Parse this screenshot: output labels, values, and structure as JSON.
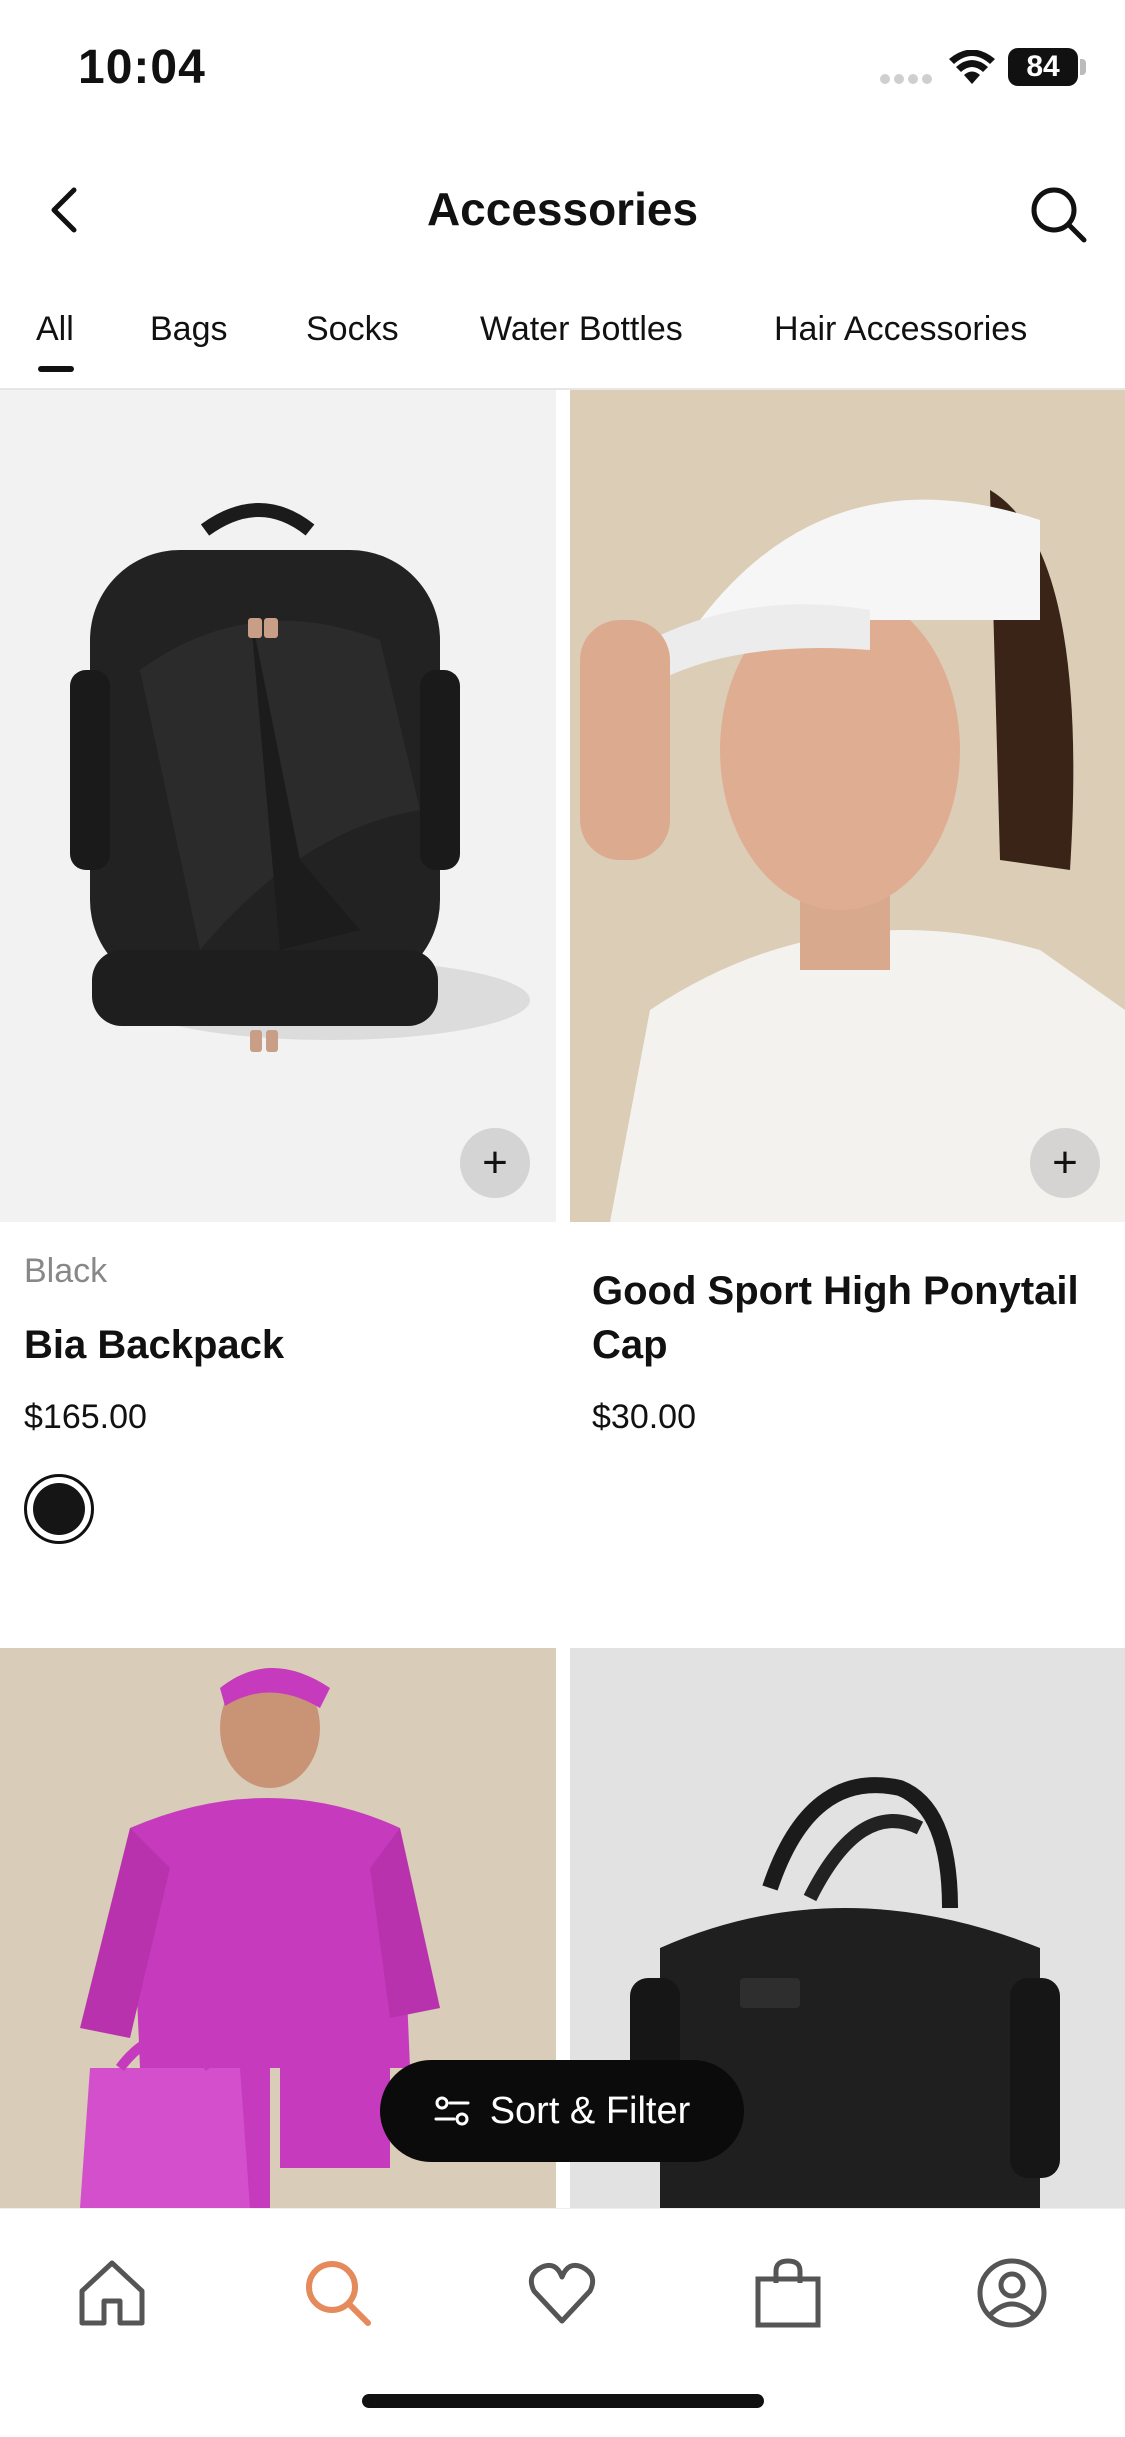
{
  "status_bar": {
    "time": "10:04",
    "battery": "84"
  },
  "header": {
    "title": "Accessories"
  },
  "tabs": [
    {
      "label": "All",
      "active": true
    },
    {
      "label": "Bags"
    },
    {
      "label": "Socks"
    },
    {
      "label": "Water Bottles"
    },
    {
      "label": "Hair Accessories"
    }
  ],
  "products": [
    {
      "color_label": "Black",
      "name": "Bia Backpack",
      "price": "$165.00",
      "swatch_color": "#151515"
    },
    {
      "name_line1": "Good Sport High Ponytail",
      "name_line2": "Cap",
      "price": "$30.00"
    }
  ],
  "sort_filter": {
    "label": "Sort & Filter"
  },
  "tabbar": {
    "items": [
      {
        "icon": "home-icon"
      },
      {
        "icon": "search-icon",
        "active": true,
        "color": "#E58A5B"
      },
      {
        "icon": "heart-icon"
      },
      {
        "icon": "bag-icon"
      },
      {
        "icon": "profile-icon"
      }
    ]
  }
}
